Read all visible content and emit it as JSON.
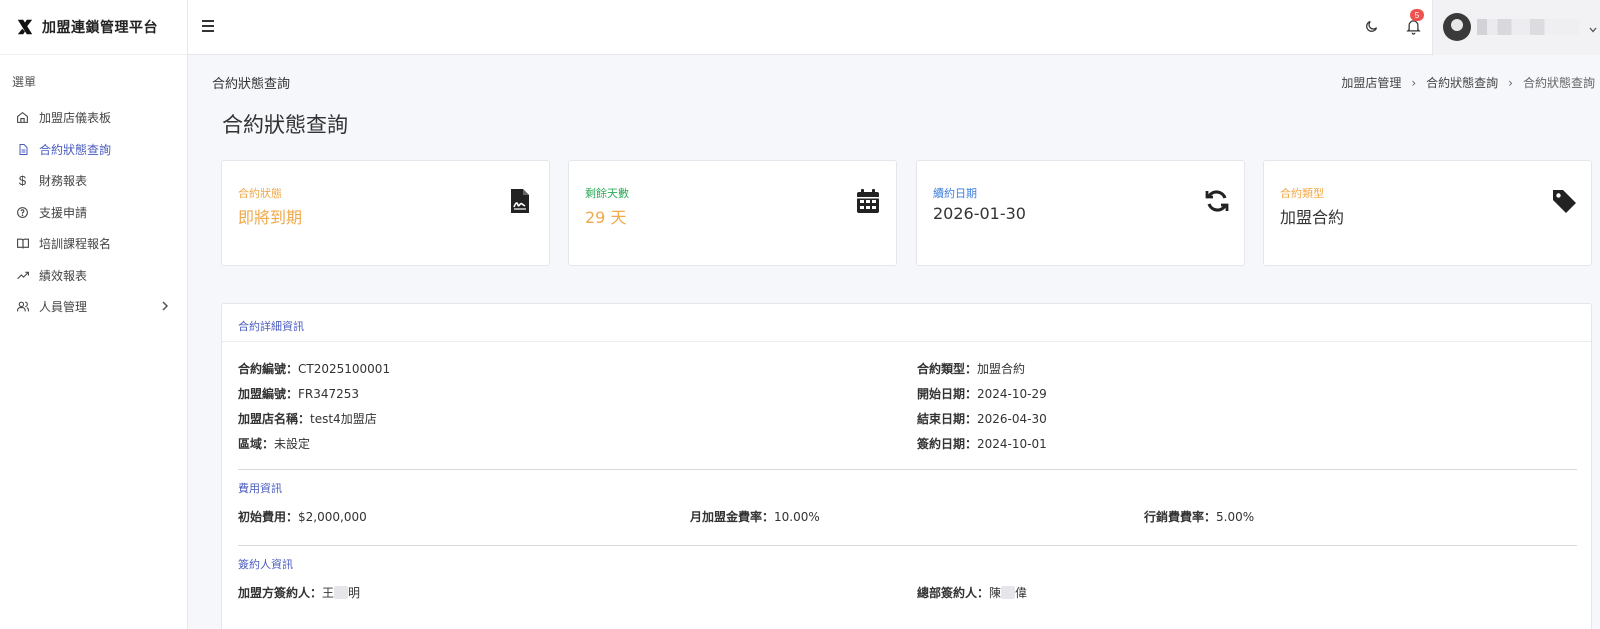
{
  "brand": {
    "name": "加盟連鎖管理平台"
  },
  "sidebar": {
    "menu_title": "選單",
    "items": [
      {
        "label": "加盟店儀表板",
        "icon": "home-icon"
      },
      {
        "label": "合約狀態查詢",
        "icon": "document-icon",
        "active": true
      },
      {
        "label": "財務報表",
        "icon": "dollar-icon"
      },
      {
        "label": "支援申請",
        "icon": "help-circle-icon"
      },
      {
        "label": "培訓課程報名",
        "icon": "book-icon"
      },
      {
        "label": "績效報表",
        "icon": "trending-up-icon"
      },
      {
        "label": "人員管理",
        "icon": "users-icon",
        "has_children": true
      }
    ]
  },
  "topbar": {
    "notification_count": "5"
  },
  "header": {
    "section_title": "合約狀態查詢",
    "breadcrumb": [
      "加盟店管理",
      "合約狀態查詢",
      "合約狀態查詢"
    ]
  },
  "page": {
    "title": "合約狀態查詢"
  },
  "cards": [
    {
      "label": "合約狀態",
      "value": "即將到期",
      "label_color": "#f0a94a",
      "value_color": "#f0a94a",
      "icon": "file-signature-icon"
    },
    {
      "label": "剩餘天數",
      "value": "29 天",
      "label_color": "#2eaa5a",
      "value_color": "#f0a94a",
      "icon": "calendar-icon"
    },
    {
      "label": "續約日期",
      "value": "2026-01-30",
      "label_color": "#3d7ee0",
      "value_color": "#333333",
      "icon": "sync-icon"
    },
    {
      "label": "合約類型",
      "value": "加盟合約",
      "label_color": "#f0a94a",
      "value_color": "#333333",
      "icon": "tag-icon"
    }
  ],
  "detail": {
    "title": "合約詳細資訊",
    "left": [
      {
        "label": "合約編號：",
        "value": "CT2025100001"
      },
      {
        "label": "加盟編號：",
        "value": "FR347253"
      },
      {
        "label": "加盟店名稱：",
        "value": "test4加盟店"
      },
      {
        "label": "區域：",
        "value": "未設定"
      }
    ],
    "right": [
      {
        "label": "合約類型：",
        "value": "加盟合約"
      },
      {
        "label": "開始日期：",
        "value": "2024-10-29"
      },
      {
        "label": "結束日期：",
        "value": "2026-04-30"
      },
      {
        "label": "簽約日期：",
        "value": "2024-10-01"
      }
    ],
    "fees_title": "費用資訊",
    "fees": [
      {
        "label": "初始費用：",
        "value": "$2,000,000"
      },
      {
        "label": "月加盟金費率：",
        "value": "10.00%"
      },
      {
        "label": "行銷費費率：",
        "value": "5.00%"
      }
    ],
    "signers_title": "簽約人資訊",
    "signers": [
      {
        "label": "加盟方簽約人：",
        "value_a": "王",
        "value_b": "明"
      },
      {
        "label": "總部簽約人：",
        "value_a": "陳",
        "value_b": "偉"
      }
    ]
  },
  "colors": {
    "accent": "#4a5bbf",
    "warning": "#f0a94a",
    "success": "#2eaa5a",
    "info": "#3d7ee0",
    "badge": "#ef5350"
  }
}
